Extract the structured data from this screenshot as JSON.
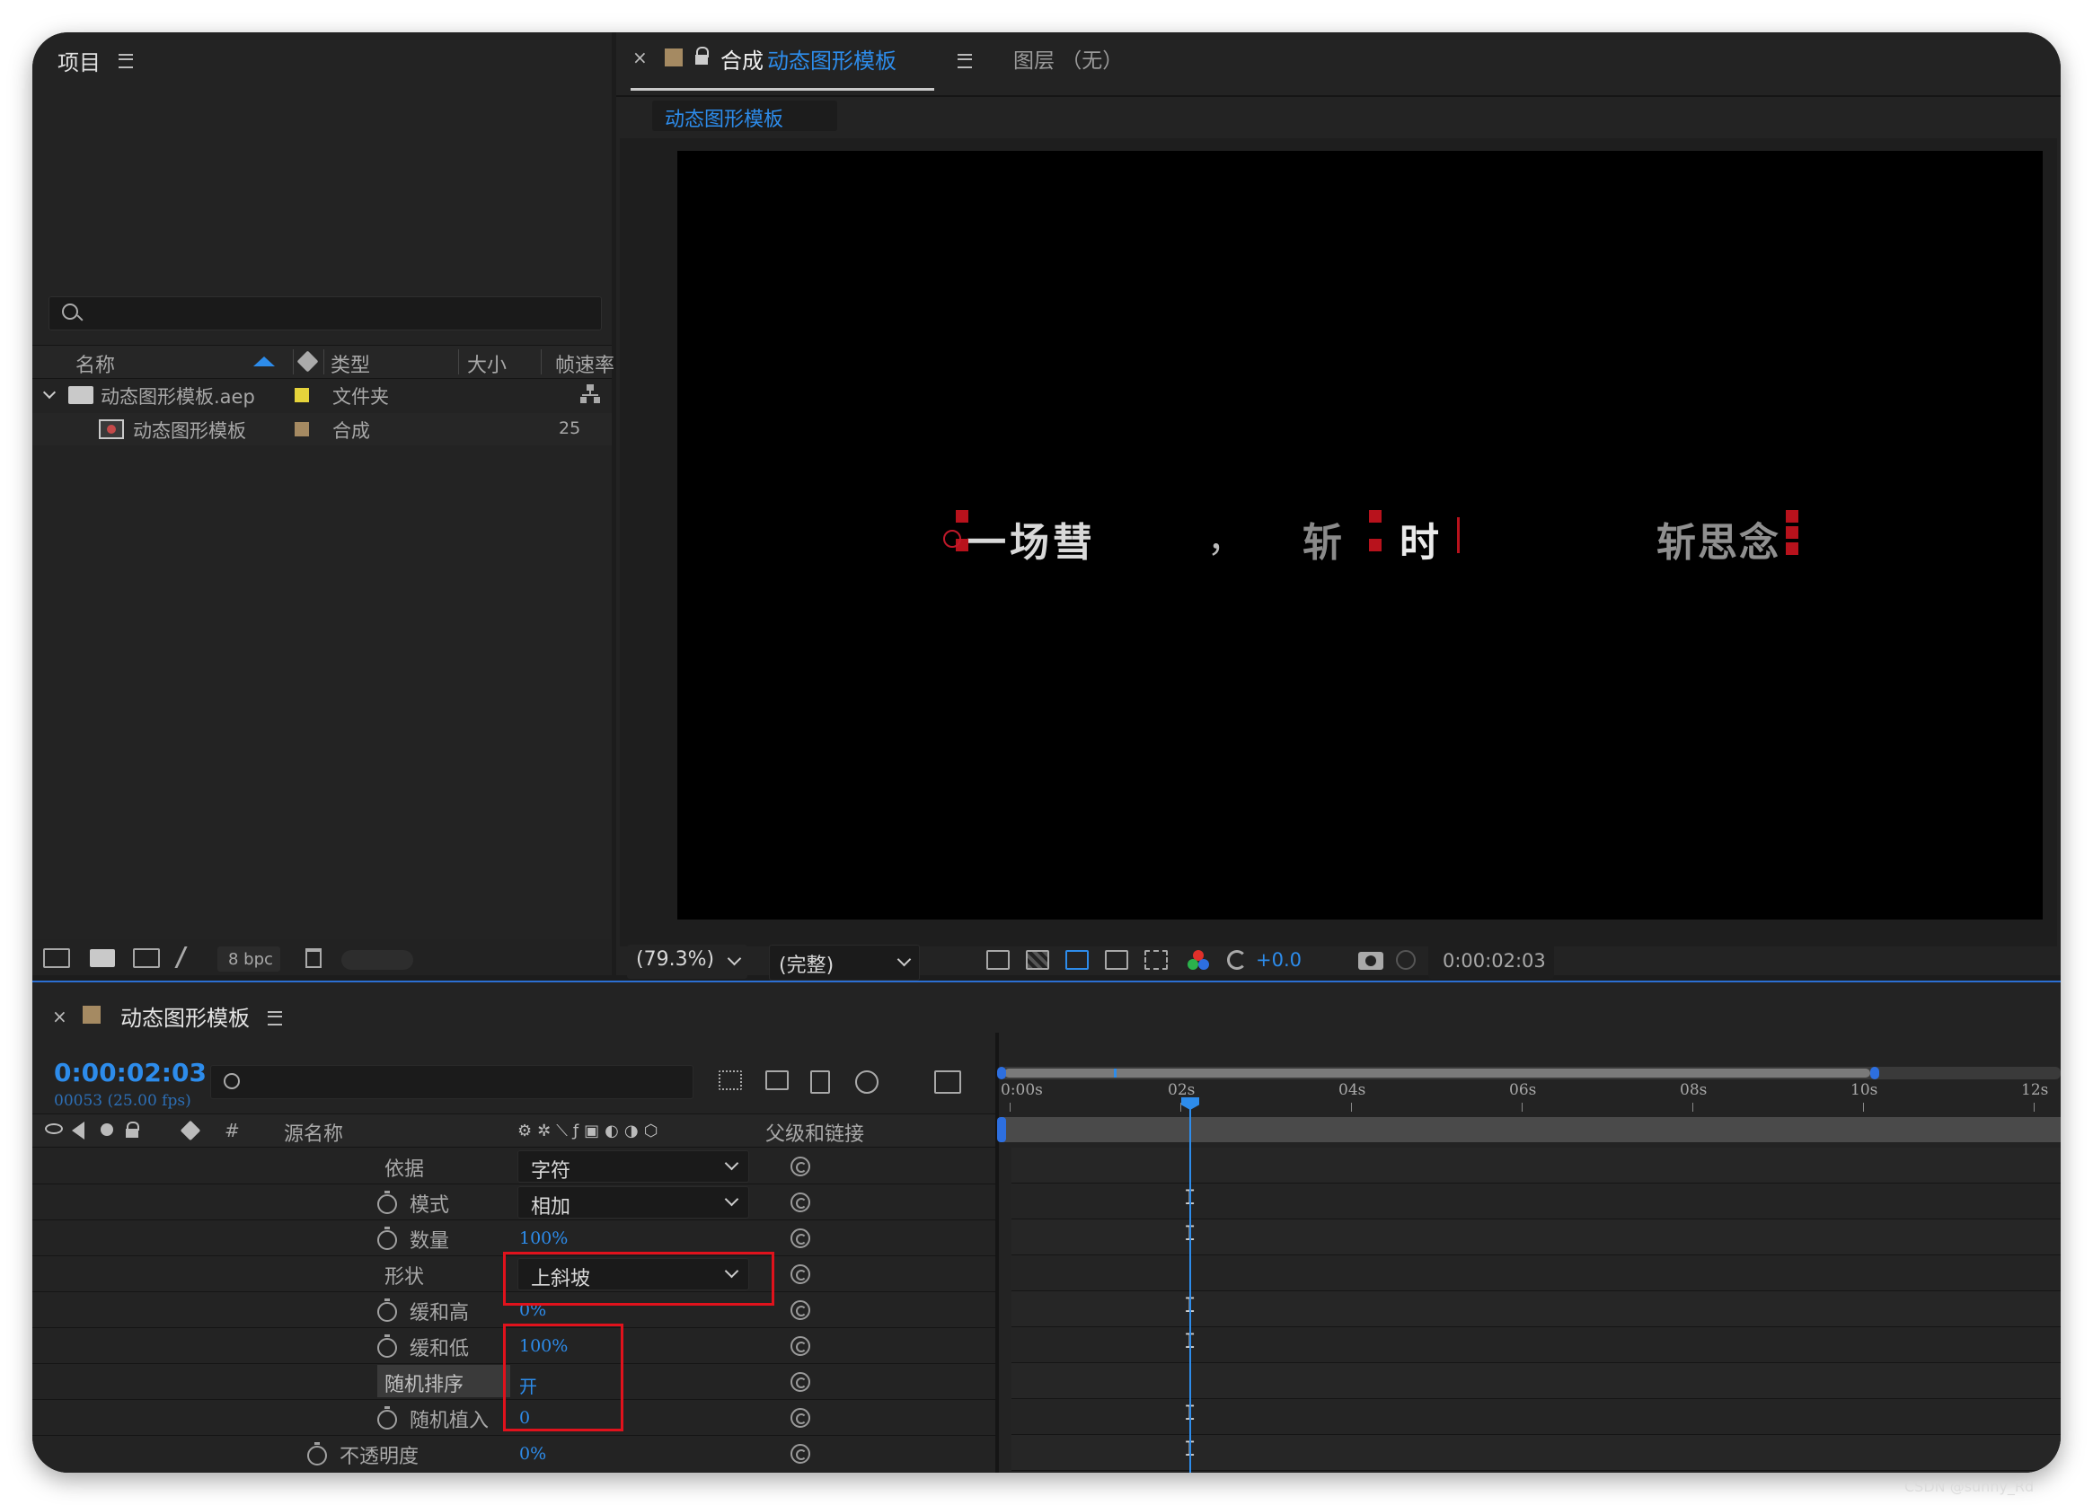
{
  "project": {
    "title": "项目",
    "columns": [
      "名称",
      "类型",
      "大小",
      "帧速率"
    ],
    "items": [
      {
        "name": "动态图形模板.aep",
        "type": "文件夹",
        "size": "",
        "fps": "",
        "swatch": "#e5d33b"
      },
      {
        "name": "动态图形模板",
        "type": "合成",
        "size": "",
        "fps": "25",
        "swatch": "#a58a62"
      }
    ],
    "bpc": "8 bpc"
  },
  "viewer": {
    "comp_prefix": "合成",
    "comp_name": "动态图形模板",
    "layer_tab": "图层 （无）",
    "breadcrumb": "动态图形模板",
    "preview_text": {
      "a": "一场彗",
      "b": "，",
      "c": "斩",
      "d": "时",
      "e": "斩思念"
    },
    "zoom": "(79.3%)",
    "resolution": "(完整)",
    "exposure": "+0.0",
    "timecode": "0:00:02:03"
  },
  "timeline": {
    "title": "动态图形模板",
    "timecode": "0:00:02:03",
    "frame_info": "00053 (25.00 fps)",
    "col_hash": "#",
    "col_source": "源名称",
    "col_parent": "父级和链接",
    "ruler": [
      "0:00s",
      "02s",
      "04s",
      "06s",
      "08s",
      "10s",
      "12s"
    ],
    "properties": [
      {
        "label": "依据",
        "value": "字符",
        "kind": "dropdown",
        "stopwatch": false
      },
      {
        "label": "模式",
        "value": "相加",
        "kind": "dropdown",
        "stopwatch": true
      },
      {
        "label": "数量",
        "value": "100%",
        "kind": "value",
        "stopwatch": true
      },
      {
        "label": "形状",
        "value": "上斜坡",
        "kind": "dropdown",
        "stopwatch": false
      },
      {
        "label": "缓和高",
        "value": "0%",
        "kind": "value",
        "stopwatch": true
      },
      {
        "label": "缓和低",
        "value": "100%",
        "kind": "value",
        "stopwatch": true
      },
      {
        "label": "随机排序",
        "value": "开",
        "kind": "value",
        "stopwatch": false
      },
      {
        "label": "随机植入",
        "value": "0",
        "kind": "value",
        "stopwatch": true
      },
      {
        "label": "不透明度",
        "value": "0%",
        "kind": "value",
        "stopwatch": true
      }
    ],
    "playhead_fraction": 0.178,
    "work_area_end_fraction": 0.82
  },
  "watermark": "CSDN @sunny_Rd",
  "colors": {
    "accent": "#2d8ceb",
    "highlight": "#e0121c",
    "panel": "#232323"
  }
}
